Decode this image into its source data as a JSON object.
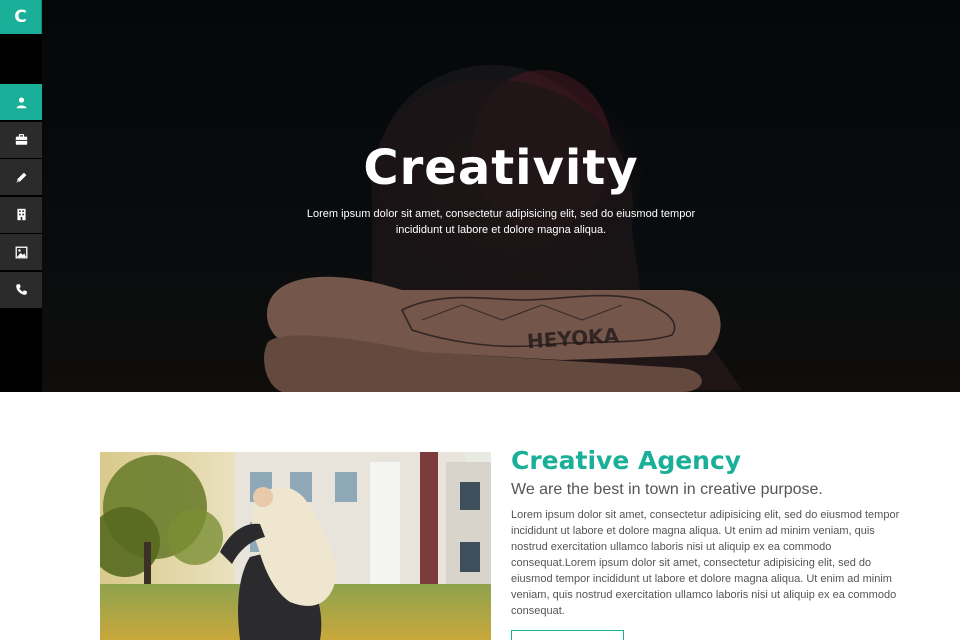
{
  "colors": {
    "accent": "#1aaf98",
    "sidebar_bg": "#000000",
    "nav_item_bg": "#2b2b2b",
    "body_text": "#555555"
  },
  "sidebar": {
    "logo": "C",
    "items": [
      {
        "icon": "user-icon",
        "active": true
      },
      {
        "icon": "briefcase-icon",
        "active": false
      },
      {
        "icon": "pencil-icon",
        "active": false
      },
      {
        "icon": "building-icon",
        "active": false
      },
      {
        "icon": "image-icon",
        "active": false
      },
      {
        "icon": "phone-icon",
        "active": false
      }
    ]
  },
  "hero": {
    "title": "Creativity",
    "text": "Lorem ipsum dolor sit amet, consectetur adipisicing elit, sed do eiusmod tempor incididunt ut labore et dolore magna aliqua.",
    "image_text": "HEYOKA"
  },
  "about": {
    "title": "Creative Agency",
    "subtitle": "We are the best in town in creative purpose.",
    "body": "Lorem ipsum dolor sit amet, consectetur adipisicing elit, sed do eiusmod tempor incididunt ut labore et dolore magna aliqua. Ut enim ad minim veniam, quis nostrud exercitation ullamco laboris nisi ut aliquip ex ea commodo consequat.Lorem ipsum dolor sit amet, consectetur adipisicing elit, sed do eiusmod tempor incididunt ut labore et dolore magna aliqua. Ut enim ad minim veniam, quis nostrud exercitation ullamco laboris nisi ut aliquip ex ea commodo consequat."
  }
}
